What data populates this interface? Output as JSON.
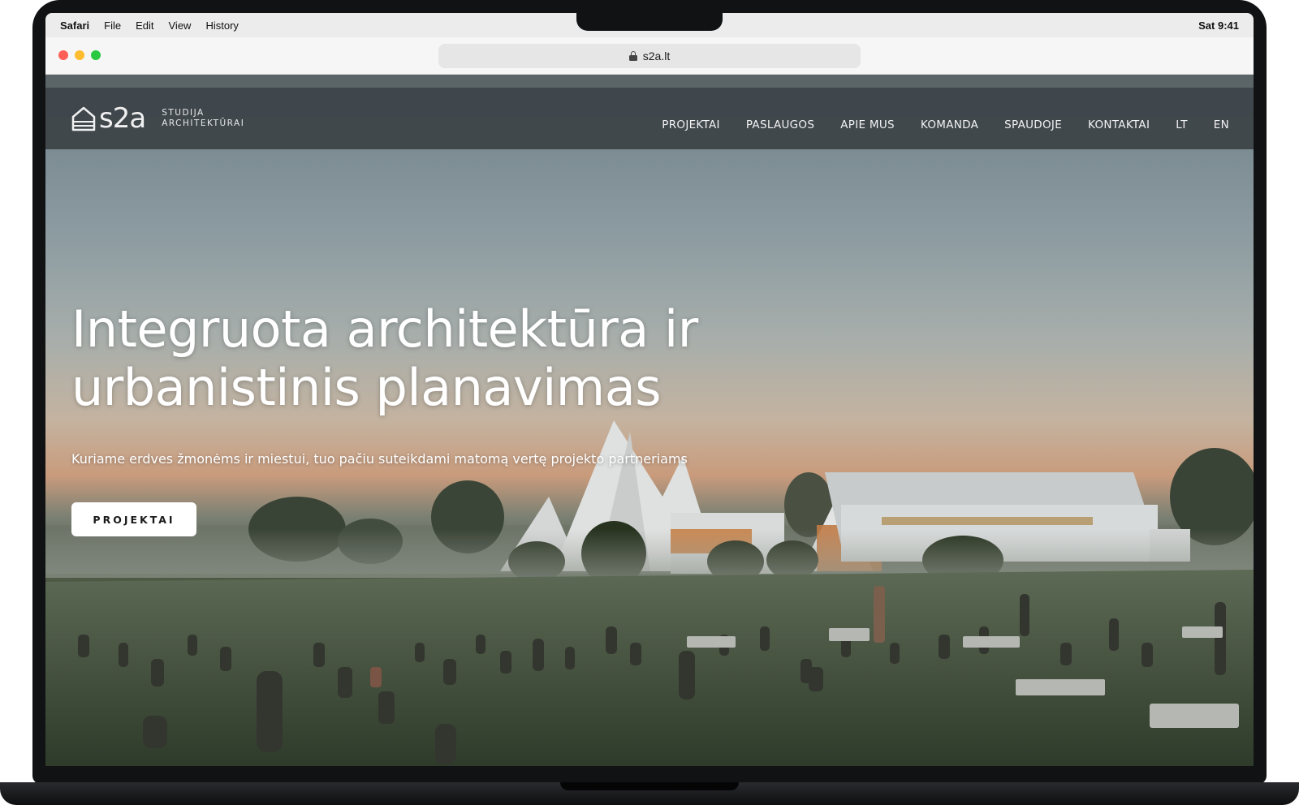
{
  "os_menubar": {
    "app_name": "Safari",
    "menus": [
      "File",
      "Edit",
      "View",
      "History"
    ],
    "clock": "Sat 9:41"
  },
  "browser": {
    "url": "s2a.lt"
  },
  "site": {
    "logo": {
      "wordmark": "s2a",
      "tagline_line1": "STUDIJA",
      "tagline_line2": "ARCHITEKTŪRAI"
    },
    "nav": [
      {
        "label": "PROJEKTAI"
      },
      {
        "label": "PASLAUGOS"
      },
      {
        "label": "APIE MUS"
      },
      {
        "label": "KOMANDA"
      },
      {
        "label": "SPAUDOJE"
      },
      {
        "label": "KONTAKTAI"
      },
      {
        "label": "LT"
      },
      {
        "label": "EN"
      }
    ],
    "hero": {
      "title_line1": "Integruota architektūra ir",
      "title_line2": "urbanistinis planavimas",
      "subtitle": "Kuriame erdves žmonėms ir miestui, tuo pačiu suteikdami matomą vertę projekto partneriams",
      "cta_label": "PROJEKTAI"
    }
  },
  "colors": {
    "header_bg": "#3c4246",
    "cta_bg": "#ffffff",
    "traffic_red": "#ff5f57",
    "traffic_yellow": "#febc2e",
    "traffic_green": "#28c840"
  }
}
